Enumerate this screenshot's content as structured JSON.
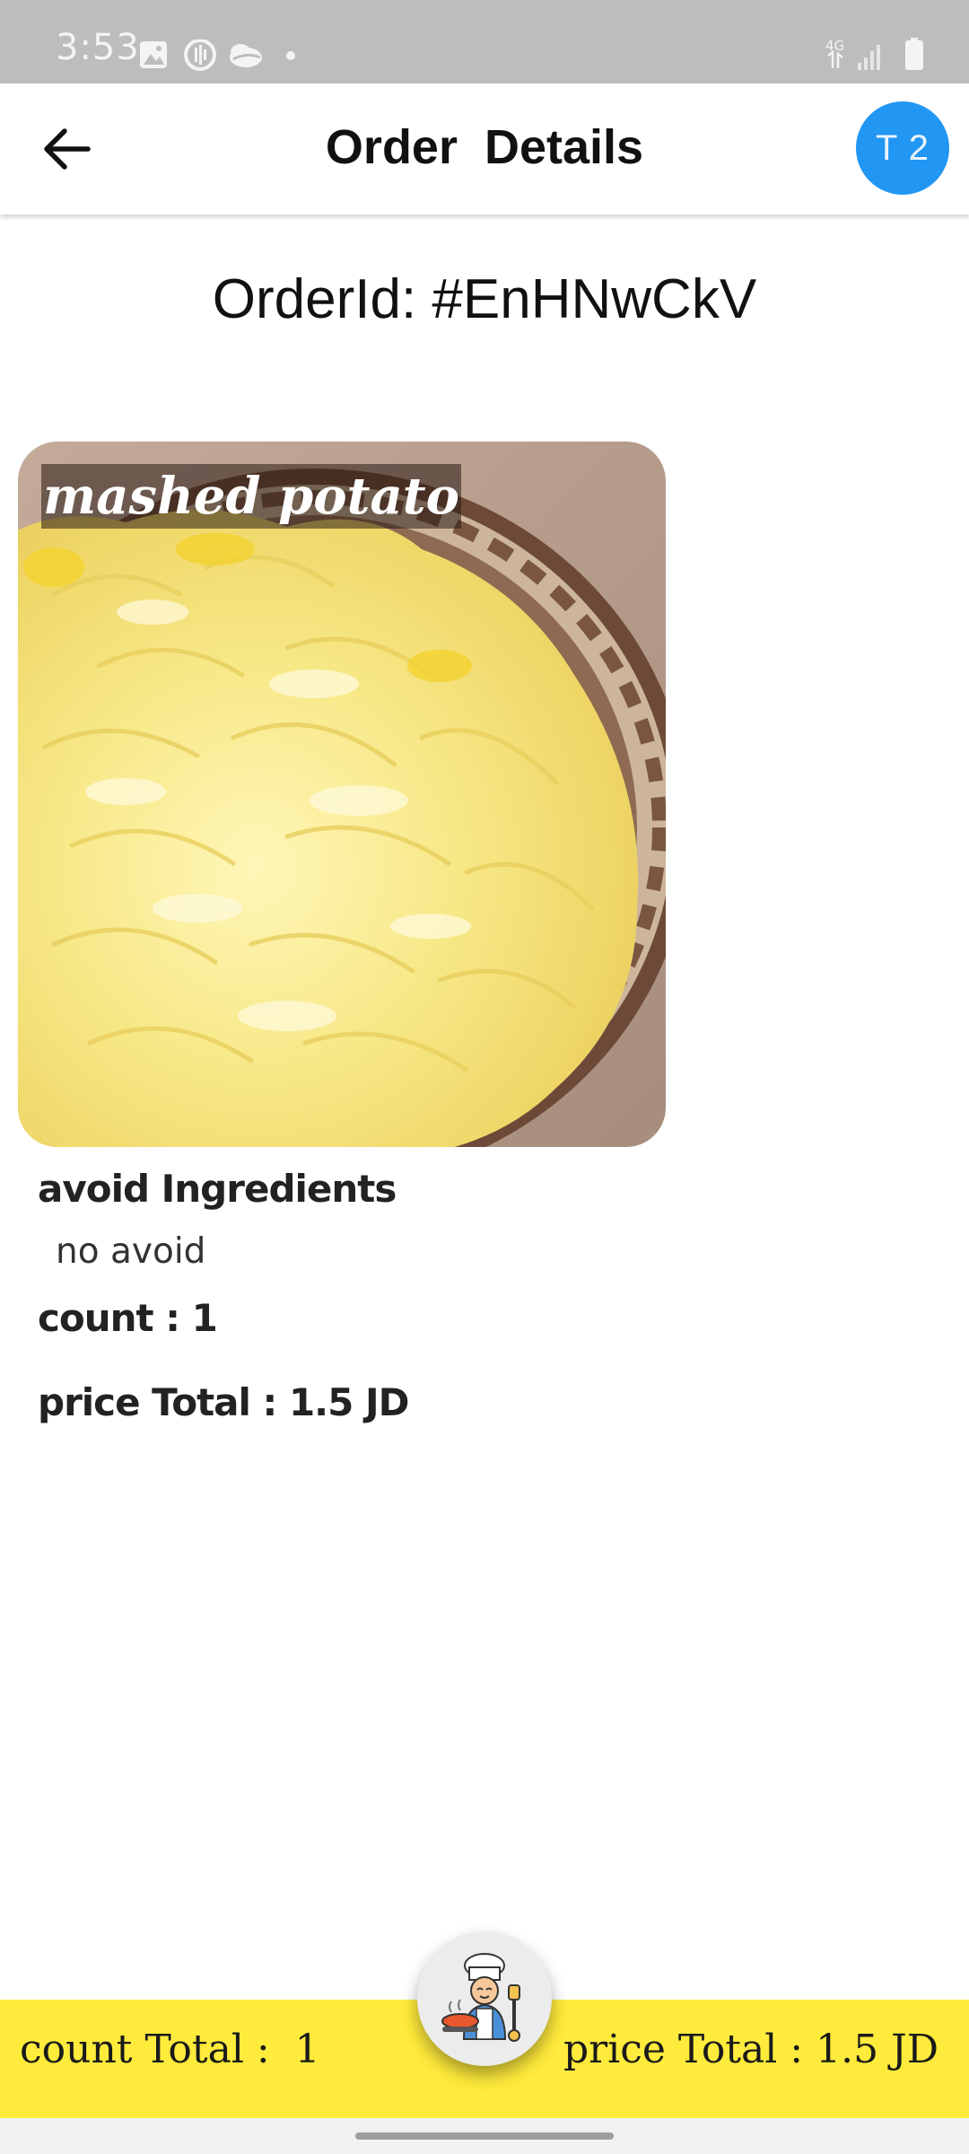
{
  "status_bar": {
    "time": "3:53",
    "icons_left": [
      "image-icon",
      "podcast-icon",
      "cloud-icon",
      "dot-icon"
    ],
    "network_label": "4G",
    "icons_right": [
      "signal-icon",
      "battery-icon"
    ]
  },
  "app_bar": {
    "title": "Order  Details",
    "back_icon": "arrow-left-icon",
    "table_badge": "T 2",
    "accent_color": "#2196f3"
  },
  "order": {
    "id_label": "OrderId: #EnHNwCkV"
  },
  "items": [
    {
      "name": "mashed potato",
      "avoid_heading": "avoid Ingredients",
      "avoid_value": "no avoid",
      "count_label": "count : 1",
      "price_label": "price Total : 1.5 JD"
    }
  ],
  "bottom_bar": {
    "count_total": "count Total :  1",
    "price_total": "price Total : 1.5 JD",
    "background_color": "#ffeb3b",
    "fab_icon": "chef-icon"
  }
}
